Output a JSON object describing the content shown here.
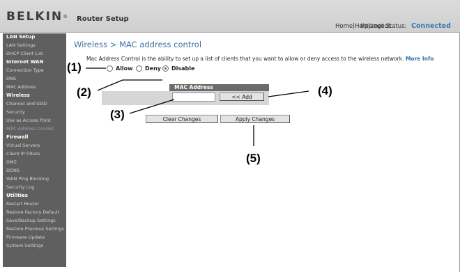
{
  "header": {
    "logo": "BELKIN",
    "logo_mark": "®",
    "title": "Router Setup",
    "links": [
      "Home",
      "Help",
      "Logout"
    ],
    "separator": "|",
    "status_label": "Internet Status:",
    "status_value": "Connected"
  },
  "sidebar": {
    "items": [
      {
        "label": "LAN Setup",
        "type": "header"
      },
      {
        "label": "LAN Settings",
        "type": "link"
      },
      {
        "label": "DHCP Client List",
        "type": "link"
      },
      {
        "label": "Internet WAN",
        "type": "header"
      },
      {
        "label": "Connection Type",
        "type": "link"
      },
      {
        "label": "DNS",
        "type": "link"
      },
      {
        "label": "MAC Address",
        "type": "link"
      },
      {
        "label": "Wireless",
        "type": "header"
      },
      {
        "label": "Channel and SSID",
        "type": "link"
      },
      {
        "label": "Security",
        "type": "link"
      },
      {
        "label": "Use as Access Point",
        "type": "link"
      },
      {
        "label": "MAC Address Control",
        "type": "active"
      },
      {
        "label": "Firewall",
        "type": "header"
      },
      {
        "label": "Virtual Servers",
        "type": "link"
      },
      {
        "label": "Client IP Filters",
        "type": "link"
      },
      {
        "label": "DMZ",
        "type": "link"
      },
      {
        "label": "DDNS",
        "type": "link"
      },
      {
        "label": "WAN Ping Blocking",
        "type": "link"
      },
      {
        "label": "Security Log",
        "type": "link"
      },
      {
        "label": "Utilities",
        "type": "header"
      },
      {
        "label": "Restart Router",
        "type": "link"
      },
      {
        "label": "Restore Factory Default",
        "type": "link"
      },
      {
        "label": "Save/Backup Settings",
        "type": "link"
      },
      {
        "label": "Restore Previous Settings",
        "type": "link"
      },
      {
        "label": "Firmware Update",
        "type": "link"
      },
      {
        "label": "System Settings",
        "type": "link"
      }
    ]
  },
  "main": {
    "title": "Wireless > MAC address control",
    "description": "Mac Address Control is the ability to set up a list of clients that you want to allow or deny access to the wireless network.",
    "more_info": "More Info",
    "mode_options": [
      {
        "label": "Allow",
        "checked": false
      },
      {
        "label": "Deny",
        "checked": false
      },
      {
        "label": "Disable",
        "checked": true
      }
    ],
    "table_header": "MAC Address",
    "mac_input_value": "",
    "add_label": "<< Add",
    "clear_label": "Clear Changes",
    "apply_label": "Apply Changes"
  },
  "callouts": [
    "(1)",
    "(2)",
    "(3)",
    "(4)",
    "(5)"
  ]
}
